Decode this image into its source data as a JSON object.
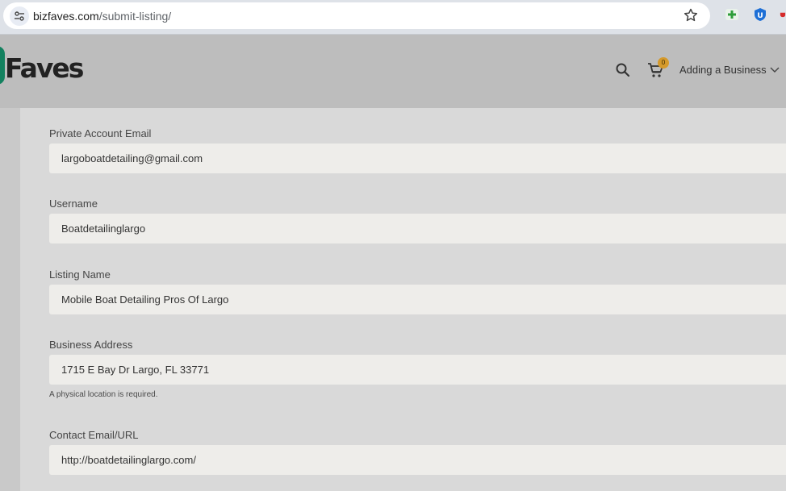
{
  "browser": {
    "url_domain": "bizfaves.com",
    "url_path": "/submit-listing/"
  },
  "header": {
    "logo_text": "Faves",
    "cart_count": "0",
    "menu_label": "Adding a Business"
  },
  "form": {
    "email": {
      "label": "Private Account Email",
      "value": "largoboatdetailing@gmail.com"
    },
    "username": {
      "label": "Username",
      "value": "Boatdetailinglargo"
    },
    "listing_name": {
      "label": "Listing Name",
      "value": "Mobile Boat Detailing Pros Of Largo"
    },
    "address": {
      "label": "Business Address",
      "value": "1715 E Bay Dr Largo, FL 33771",
      "help": "A physical location is required."
    },
    "contact": {
      "label": "Contact Email/URL",
      "value": "http://boatdetailinglargo.com/"
    }
  },
  "colors": {
    "brand_green": "#13815f",
    "badge": "#d59a2b"
  }
}
